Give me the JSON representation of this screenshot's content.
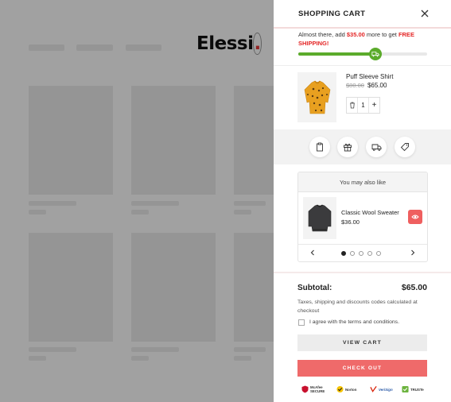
{
  "store": {
    "logo_text": "Elessi",
    "logo_dot": "."
  },
  "cart": {
    "title": "SHOPPING CART",
    "shipping": {
      "prefix": "Almost there, add ",
      "amount": "$35.00",
      "middle": " more to get ",
      "free_text": "FREE SHIPPING!",
      "progress_percent": 60,
      "color": "#5bab2b"
    },
    "item": {
      "name": "Puff Sleeve Shirt",
      "old_price": "$80.00",
      "price": "$65.00",
      "quantity": "1",
      "minus_icon": "trash-icon",
      "plus_label": "+"
    },
    "tools": [
      "note-icon",
      "gift-icon",
      "shipping-truck-icon",
      "coupon-tag-icon"
    ],
    "suggestions": {
      "heading": "You may also like",
      "product": {
        "name": "Classic Wool Sweater",
        "price": "$36.00"
      },
      "dots": 5,
      "active_dot": 0
    },
    "summary": {
      "subtotal_label": "Subtotal:",
      "subtotal_value": "$65.00",
      "tax_note": "Taxes, shipping and discounts codes calculated at checkout",
      "agree_text": "I agree with the terms and conditions."
    },
    "buttons": {
      "view_cart": "VIEW CART",
      "checkout": "CHECK OUT"
    },
    "badges": {
      "mcafee": "McAfee SECURE",
      "norton": "Norton",
      "verisign": "VeriSign",
      "truste": "TRUSTe"
    },
    "accent_color": "#ef6a6a"
  }
}
